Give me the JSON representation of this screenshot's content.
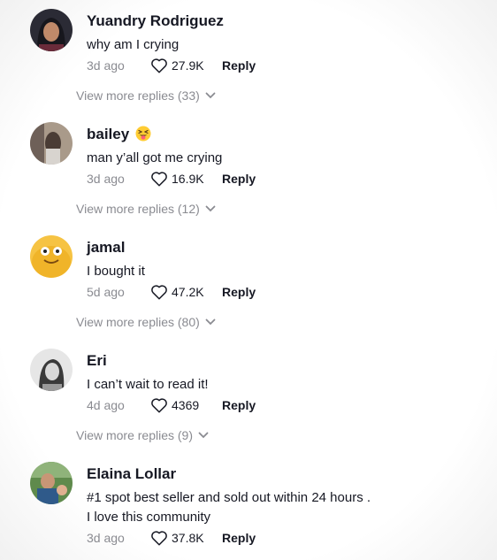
{
  "comments": [
    {
      "username": "Yuandry Rodriguez",
      "text": "why am I crying",
      "date": "3d ago",
      "likes": "27.9K",
      "reply_label": "Reply",
      "more_replies": "View more replies (33)"
    },
    {
      "username": "bailey",
      "emoji": "squinting-tongue-face",
      "text": "man y’all got me crying",
      "date": "3d ago",
      "likes": "16.9K",
      "reply_label": "Reply",
      "more_replies": "View more replies (12)"
    },
    {
      "username": "jamal",
      "text": "I bought it",
      "date": "5d ago",
      "likes": "47.2K",
      "reply_label": "Reply",
      "more_replies": "View more replies (80)"
    },
    {
      "username": "Eri",
      "text": "I can’t wait to read it!",
      "date": "4d ago",
      "likes": "4369",
      "reply_label": "Reply",
      "more_replies": "View more replies (9)"
    },
    {
      "username": "Elaina Lollar",
      "text_lines": [
        "#1 spot best seller and sold out within 24 hours .",
        "I love this community"
      ],
      "date": "3d ago",
      "likes": "37.8K",
      "reply_label": "Reply"
    }
  ],
  "icons": {
    "like": "heart-outline-icon",
    "expand": "chevron-down-icon"
  },
  "colors": {
    "text_primary": "#161823",
    "text_secondary": "#8a8b91"
  }
}
